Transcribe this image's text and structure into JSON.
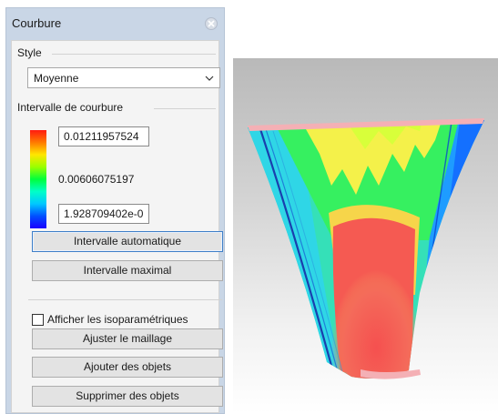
{
  "panel": {
    "title": "Courbure",
    "style_caption": "Style",
    "style_value": "Moyenne",
    "range_caption": "Intervalle de courbure",
    "max_value": "0.01211957524",
    "mid_value": "0.00606075197",
    "min_value": "1.928709402e-0",
    "auto_range_button": "Intervalle automatique",
    "max_range_button": "Intervalle maximal",
    "show_isoparms_label": "Afficher les isoparamétriques",
    "show_isoparms_checked": false,
    "adjust_mesh_button": "Ajuster le maillage",
    "add_objects_button": "Ajouter des objets",
    "remove_objects_button": "Supprimer des objets"
  },
  "gradient_colors": [
    "#ff1a10",
    "#ff7a00",
    "#ffe600",
    "#9aff00",
    "#00ff3c",
    "#00ffc8",
    "#00c8ff",
    "#0050ff",
    "#1a00ff"
  ],
  "icons": {
    "close": "close-icon",
    "dropdown": "chevron-down-icon"
  }
}
